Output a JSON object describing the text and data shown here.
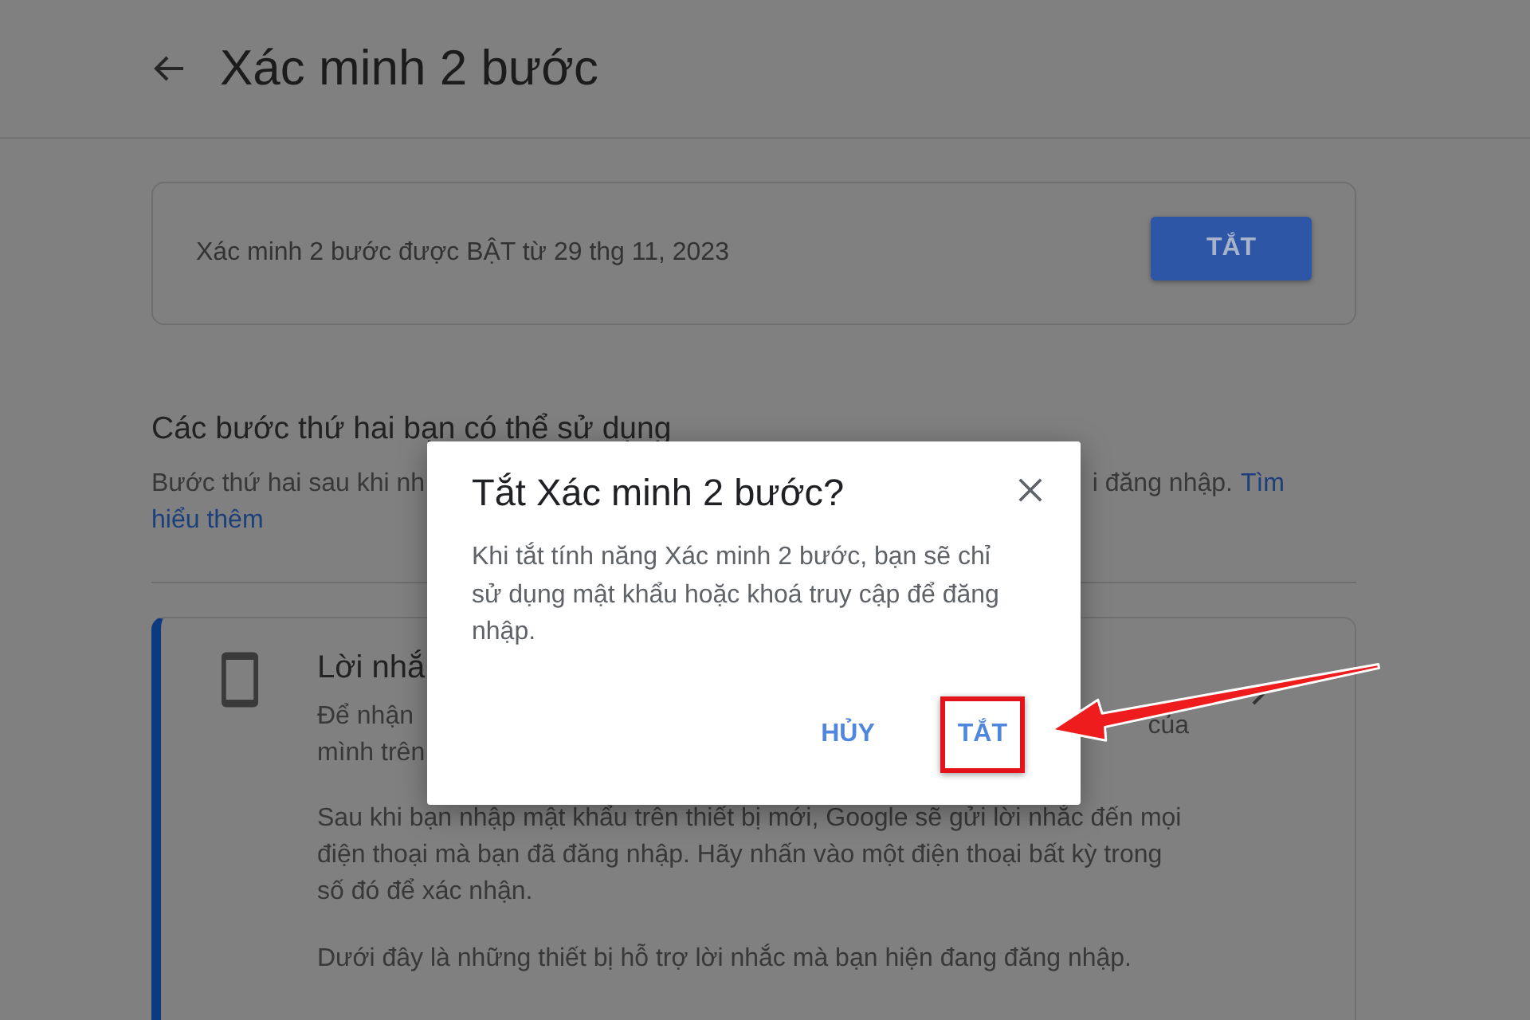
{
  "header": {
    "title": "Xác minh 2 bước"
  },
  "status_card": {
    "text": "Xác minh 2 bước được BẬT từ 29 thg 11, 2023",
    "button": "TẮT"
  },
  "second_steps": {
    "heading": "Các bước thứ hai bạn có thể sử dụng",
    "intro_left": "Bước thứ hai sau khi nh",
    "intro_right": "i đăng nhập.",
    "link_parts": [
      "Tìm",
      "hiểu thêm"
    ]
  },
  "option_card": {
    "title": "Lời nhắ",
    "lines_left": [
      "Để nhận",
      "mình trên"
    ],
    "line_right": "của",
    "paragraphs": [
      "Sau khi bạn nhập mật khẩu trên thiết bị mới, Google sẽ gửi lời nhắc đến mọi điện thoại mà bạn đã đăng nhập. Hãy nhấn vào một điện thoại bất kỳ trong số đó để xác nhận.",
      "Dưới đây là những thiết bị hỗ trợ lời nhắc mà bạn hiện đang đăng nhập."
    ]
  },
  "dialog": {
    "title": "Tắt Xác minh 2 bước?",
    "body": "Khi tắt tính năng Xác minh 2 bước, bạn sẽ chỉ sử dụng mật khẩu hoặc khoá truy cập để đăng nhập.",
    "cancel_button": {
      "label": "HỦY",
      "highlighted": false
    },
    "confirm_button": {
      "label": "TẮT",
      "highlighted": true
    }
  }
}
